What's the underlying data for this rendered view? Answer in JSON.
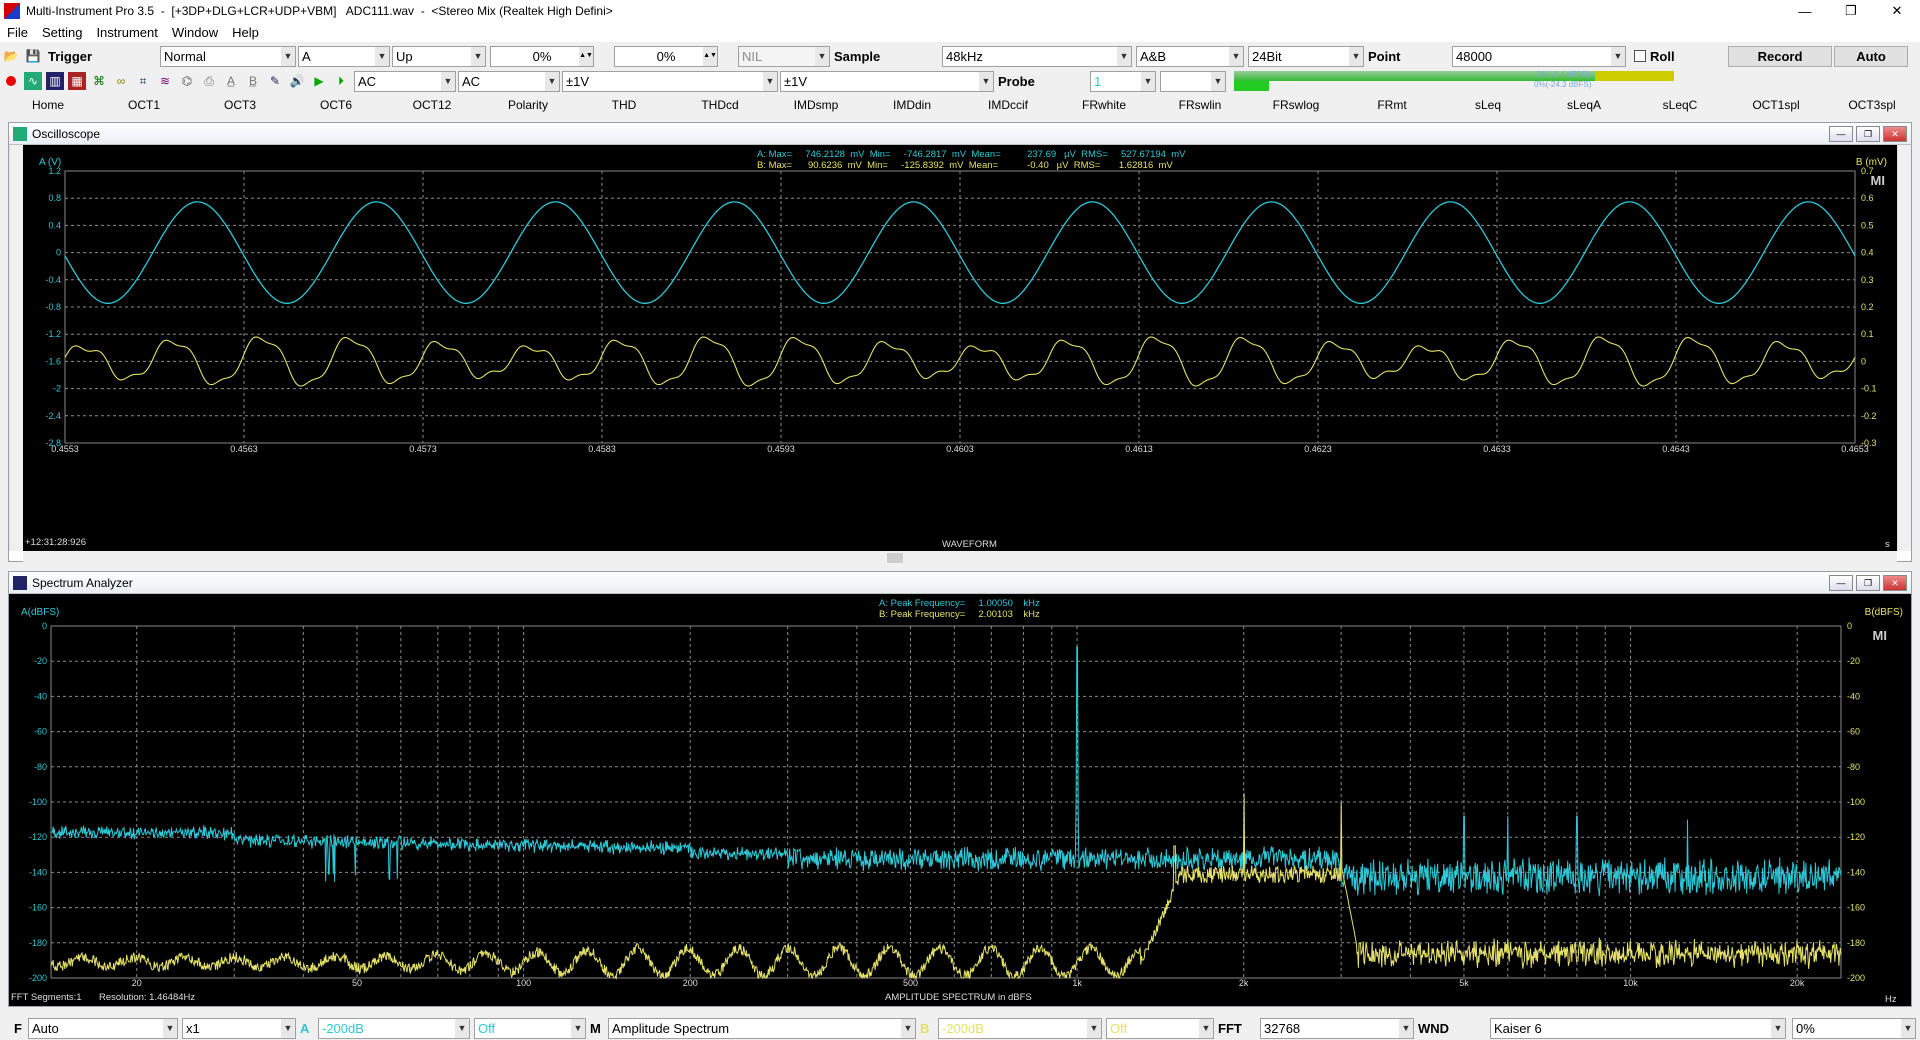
{
  "window": {
    "title": "Multi-Instrument Pro 3.5  -  [+3DP+DLG+LCR+UDP+VBM]   ADC111.wav  -  <Stereo Mix (Realtek High Defini>",
    "min": "—",
    "max": "❐",
    "close": "✕"
  },
  "menu": [
    "File",
    "Setting",
    "Instrument",
    "Window",
    "Help"
  ],
  "toolbar1": {
    "trigger_label": "Trigger",
    "trigger_mode": "Normal",
    "trigger_channel": "A",
    "trigger_edge": "Up",
    "trigger_level": "0%",
    "trigger_delay": "0%",
    "nil": "NIL",
    "sample_label": "Sample",
    "sample_rate": "48kHz",
    "channels": "A&B",
    "bits": "24Bit",
    "point_label": "Point",
    "points": "48000",
    "roll_label": "Roll",
    "record_label": "Record",
    "auto_label": "Auto"
  },
  "toolbar2": {
    "coupling_a": "AC",
    "coupling_b": "AC",
    "range_a": "±1V",
    "range_b": "±1V",
    "probe_label": "Probe",
    "probe_value": "1",
    "level_meter_a": 0.89,
    "level_meter_b": 0.05,
    "meter_a_text": "-2%(-0.4 dBFS)",
    "meter_b_text": "0%(-24.3 dBFS)"
  },
  "tabs": [
    "Home",
    "OCT1",
    "OCT3",
    "OCT6",
    "OCT12",
    "Polarity",
    "THD",
    "THDcd",
    "IMDsmp",
    "IMDdin",
    "IMDccif",
    "FRwhite",
    "FRswlin",
    "FRswlog",
    "FRmt",
    "sLeq",
    "sLeqA",
    "sLeqC",
    "OCT1spl",
    "OCT3spl"
  ],
  "oscilloscope": {
    "title": "Oscilloscope",
    "label_a": "A (V)",
    "label_b": "B (mV)",
    "stats_a": "A: Max=     746.2128  mV  Min=     -746.2817  mV  Mean=          237.69   µV  RMS=     527.67194  mV",
    "stats_b": "B: Max=      90.6236  mV  Min=     -125.8392  mV  Mean=           -0.40   µV  RMS=       1.62816  mV",
    "timestamp": "+12:31:28:926",
    "xlabel": "WAVEFORM",
    "xunit": "s",
    "mi": "MI"
  },
  "spectrum": {
    "title": "Spectrum Analyzer",
    "label_a": "A(dBFS)",
    "label_b": "B(dBFS)",
    "peak_a": "A: Peak Frequency=     1.00050    kHz",
    "peak_b": "B: Peak Frequency=     2.00103    kHz",
    "segments": "FFT Segments:1",
    "resolution": "Resolution: 1.46484Hz",
    "xlabel": "AMPLITUDE SPECTRUM in dBFS",
    "xunit": "Hz",
    "mi": "MI"
  },
  "bottombar": {
    "f_label": "F",
    "f_mode": "Auto",
    "zoom": "x1",
    "a_label": "A",
    "a_floor": "-200dB",
    "a_mode": "Off",
    "m_label": "M",
    "m_value": "Amplitude Spectrum",
    "b_label": "B",
    "b_floor": "-200dB",
    "b_mode": "Off",
    "fft_label": "FFT",
    "fft_value": "32768",
    "wnd_label": "WND",
    "wnd_value": "Kaiser 6",
    "overlap": "0%"
  },
  "colors": {
    "channel_a": "#2ec7d6",
    "channel_b": "#e4e06a",
    "grid": "#8a8a8a"
  },
  "chart_data": [
    {
      "type": "line",
      "title": "",
      "xlabel": "WAVEFORM",
      "x_ticks": [
        "0.4553",
        "0.4563",
        "0.4573",
        "0.4583",
        "0.4593",
        "0.4603",
        "0.4613",
        "0.4623",
        "0.4633",
        "0.4643",
        "0.4653"
      ],
      "y_left_ticks": [
        "1.2",
        "0.8",
        "0.4",
        "0",
        "-0.4",
        "-0.8",
        "-1.2",
        "-1.6",
        "-2",
        "-2.4",
        "-2.8"
      ],
      "y_right_ticks": [
        "0.7",
        "0.6",
        "0.5",
        "0.4",
        "0.3",
        "0.2",
        "0.1",
        "0",
        "-0.1",
        "-0.2",
        "-0.3"
      ],
      "xlim": [
        0.4553,
        0.4653
      ],
      "ylim_a": [
        -2.8,
        1.2
      ],
      "ylim_b": [
        -0.3,
        0.7
      ],
      "series": [
        {
          "name": "A",
          "frequency_hz": 1000,
          "amplitude_v": 0.746
        },
        {
          "name": "B",
          "frequency_hz": 2000,
          "amplitude_mv": 0.09
        }
      ]
    },
    {
      "type": "line",
      "title": "",
      "xlabel": "AMPLITUDE SPECTRUM in dBFS",
      "x_ticks": [
        "20",
        "50",
        "100",
        "200",
        "500",
        "1k",
        "2k",
        "5k",
        "10k",
        "20k"
      ],
      "y_left_ticks": [
        "0",
        "-20",
        "-40",
        "-60",
        "-80",
        "-100",
        "-120",
        "-140",
        "-160",
        "-180",
        "-200"
      ],
      "y_right_ticks": [
        "0",
        "-20",
        "-40",
        "-60",
        "-80",
        "-100",
        "-120",
        "-140",
        "-160",
        "-180",
        "-200"
      ],
      "xlim": [
        14,
        24000
      ],
      "ylim": [
        -200,
        0
      ],
      "x_scale": "log",
      "series": [
        {
          "name": "A",
          "peak_hz": 1000.5,
          "peak_db": -12,
          "floor_db": -135
        },
        {
          "name": "B",
          "peak_hz": 2001.0,
          "peak_db": -95,
          "floor_db": -185
        }
      ]
    }
  ]
}
